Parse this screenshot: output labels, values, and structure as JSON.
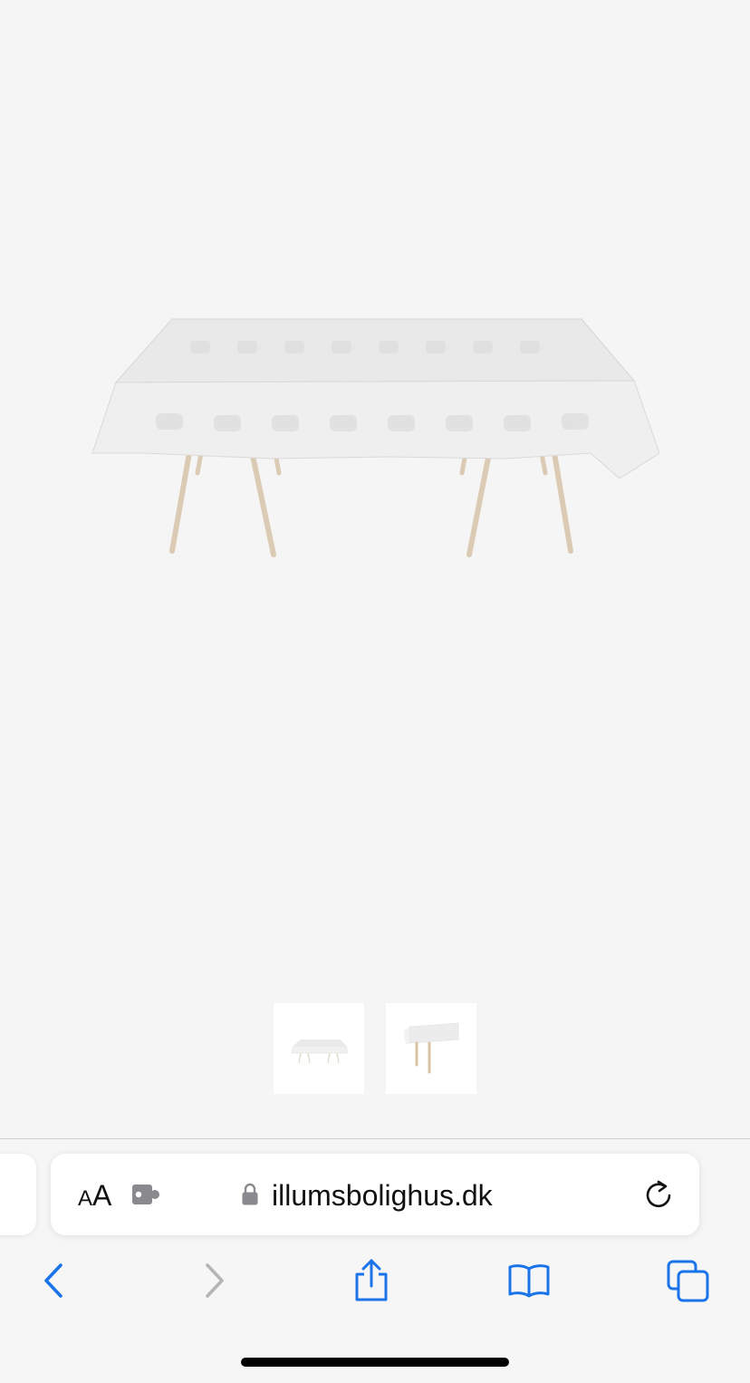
{
  "product": {
    "image_alt": "Tablecloth on table",
    "thumbnails": [
      {
        "alt": "Tablecloth front view"
      },
      {
        "alt": "Tablecloth corner view"
      }
    ]
  },
  "browser": {
    "reader_button": {
      "small": "A",
      "big": "A"
    },
    "url": "illumsbolighus.dk",
    "icons": {
      "extension": "puzzle-icon",
      "lock": "lock-icon",
      "reload": "reload-icon",
      "back": "chevron-left-icon",
      "forward": "chevron-right-icon",
      "share": "share-icon",
      "bookmarks": "book-icon",
      "tabs": "tabs-icon"
    }
  },
  "colors": {
    "accent": "#1a73e8",
    "disabled": "#b5b5b5",
    "background": "#f5f5f5"
  }
}
